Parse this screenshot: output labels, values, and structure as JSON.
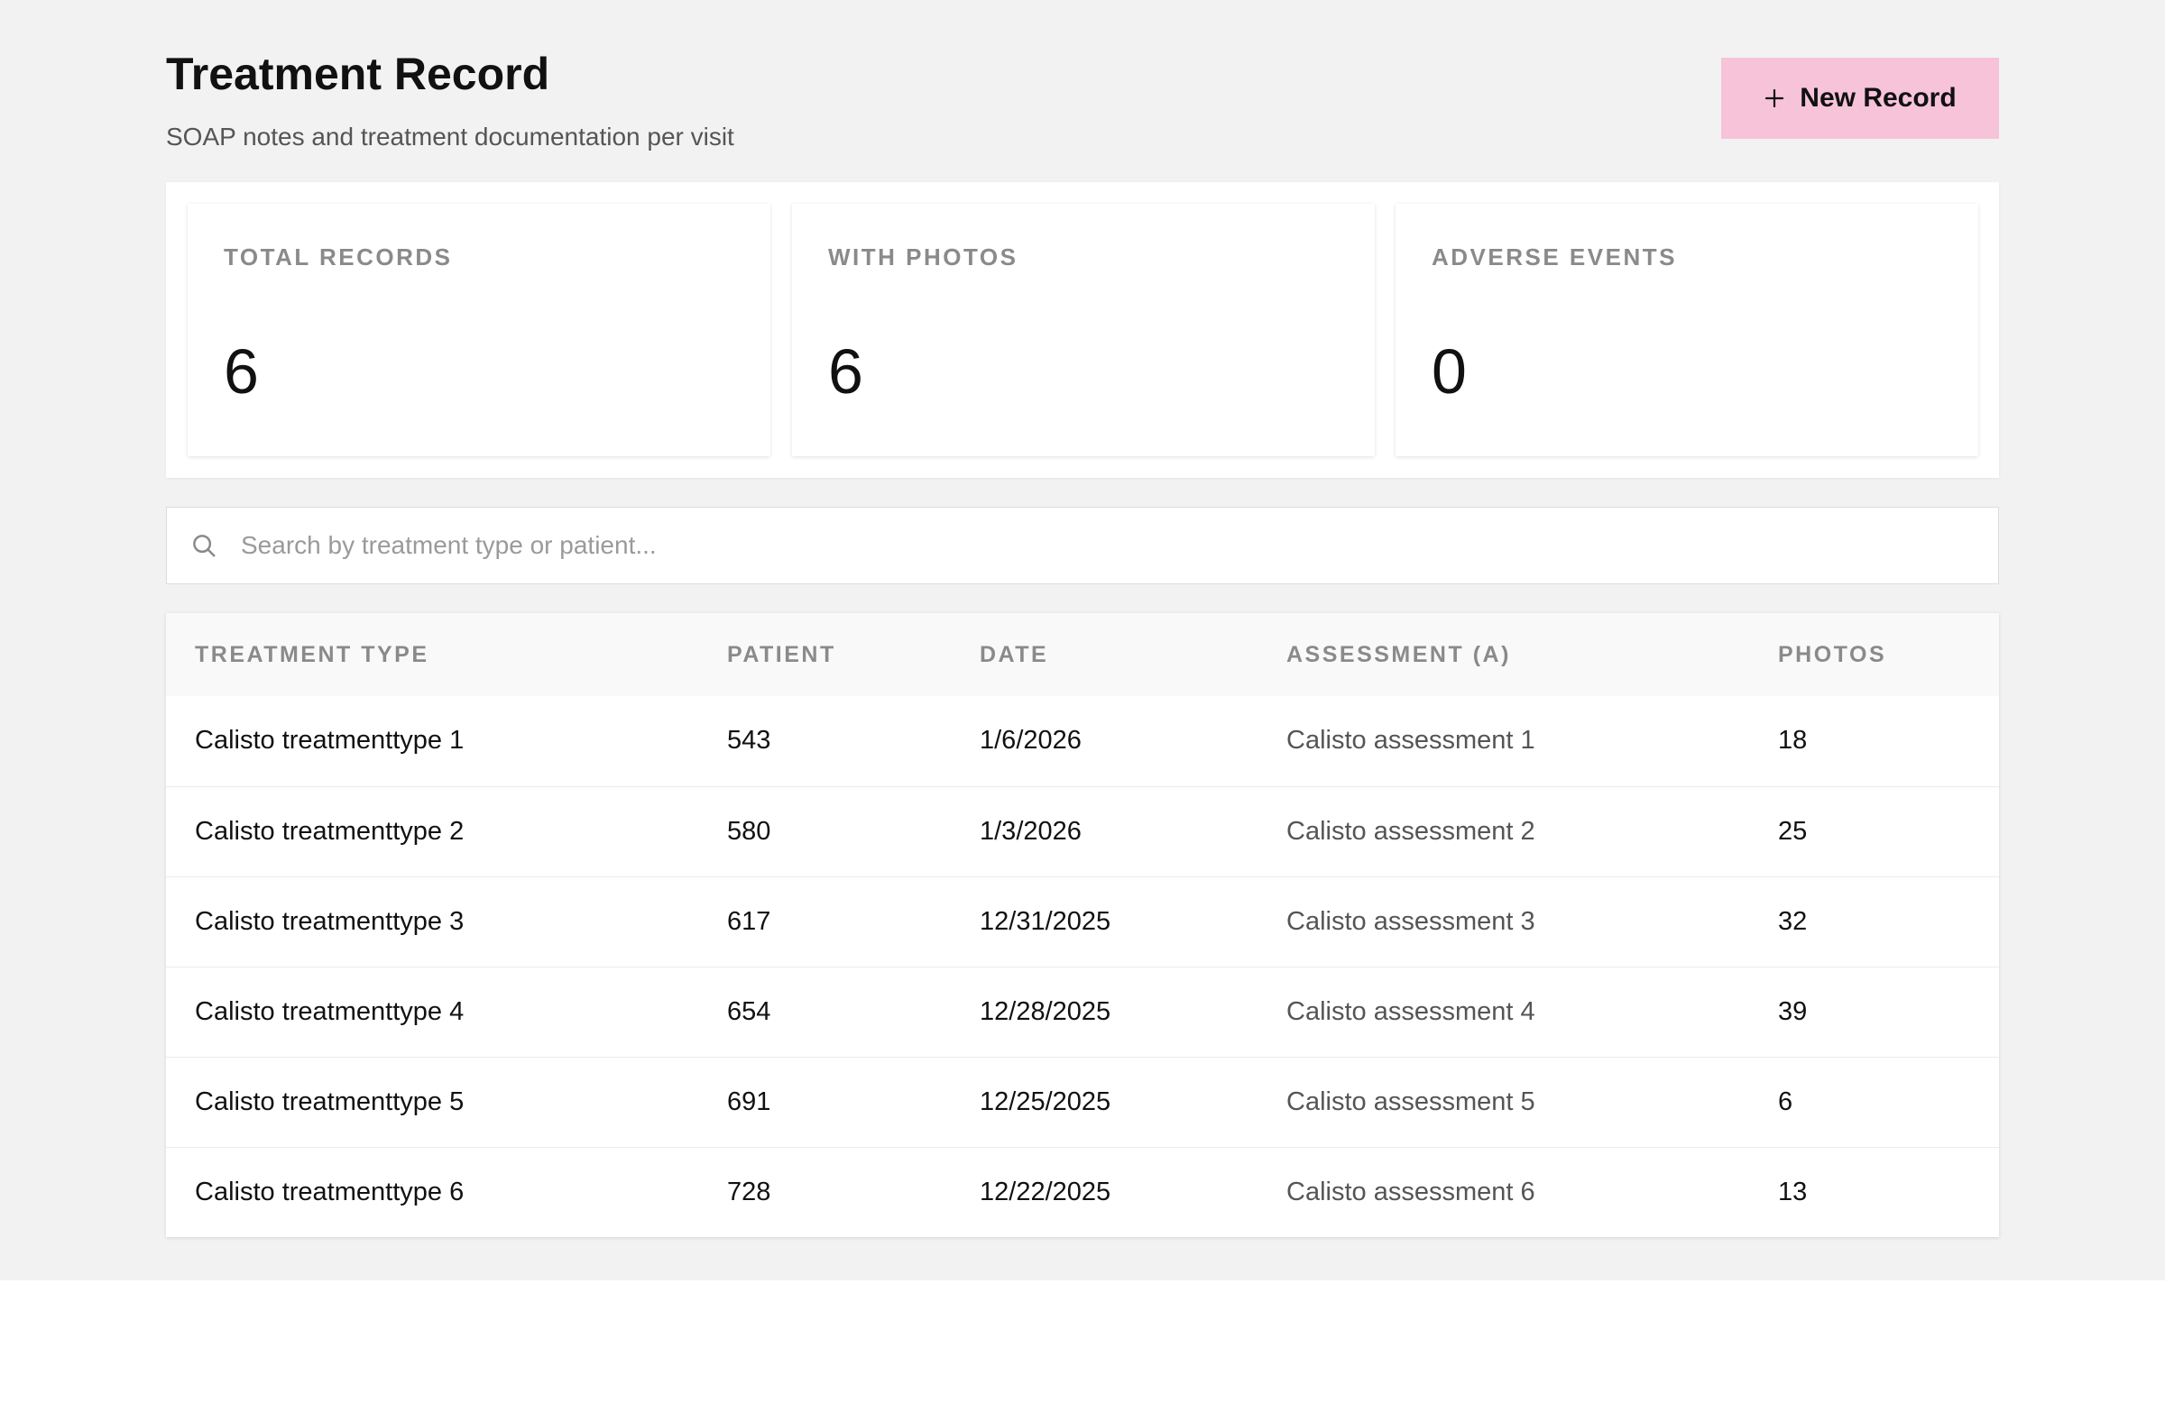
{
  "header": {
    "title": "Treatment Record",
    "subtitle": "SOAP notes and treatment documentation per visit",
    "new_button_label": "New Record"
  },
  "stats": [
    {
      "label": "TOTAL RECORDS",
      "value": "6"
    },
    {
      "label": "WITH PHOTOS",
      "value": "6"
    },
    {
      "label": "ADVERSE EVENTS",
      "value": "0"
    }
  ],
  "search": {
    "placeholder": "Search by treatment type or patient...",
    "value": ""
  },
  "table": {
    "columns": [
      "TREATMENT TYPE",
      "PATIENT",
      "DATE",
      "ASSESSMENT (A)",
      "PHOTOS"
    ],
    "rows": [
      {
        "treatment_type": "Calisto treatmenttype 1",
        "patient": "543",
        "date": "1/6/2026",
        "assessment": "Calisto assessment 1",
        "photos": "18"
      },
      {
        "treatment_type": "Calisto treatmenttype 2",
        "patient": "580",
        "date": "1/3/2026",
        "assessment": "Calisto assessment 2",
        "photos": "25"
      },
      {
        "treatment_type": "Calisto treatmenttype 3",
        "patient": "617",
        "date": "12/31/2025",
        "assessment": "Calisto assessment 3",
        "photos": "32"
      },
      {
        "treatment_type": "Calisto treatmenttype 4",
        "patient": "654",
        "date": "12/28/2025",
        "assessment": "Calisto assessment 4",
        "photos": "39"
      },
      {
        "treatment_type": "Calisto treatmenttype 5",
        "patient": "691",
        "date": "12/25/2025",
        "assessment": "Calisto assessment 5",
        "photos": "6"
      },
      {
        "treatment_type": "Calisto treatmenttype 6",
        "patient": "728",
        "date": "12/22/2025",
        "assessment": "Calisto assessment 6",
        "photos": "13"
      }
    ]
  },
  "colors": {
    "page_background": "#f2f2f2",
    "accent_button": "#f7c3d8"
  },
  "icons": {
    "new_button": "plus-icon",
    "search": "search-icon"
  }
}
